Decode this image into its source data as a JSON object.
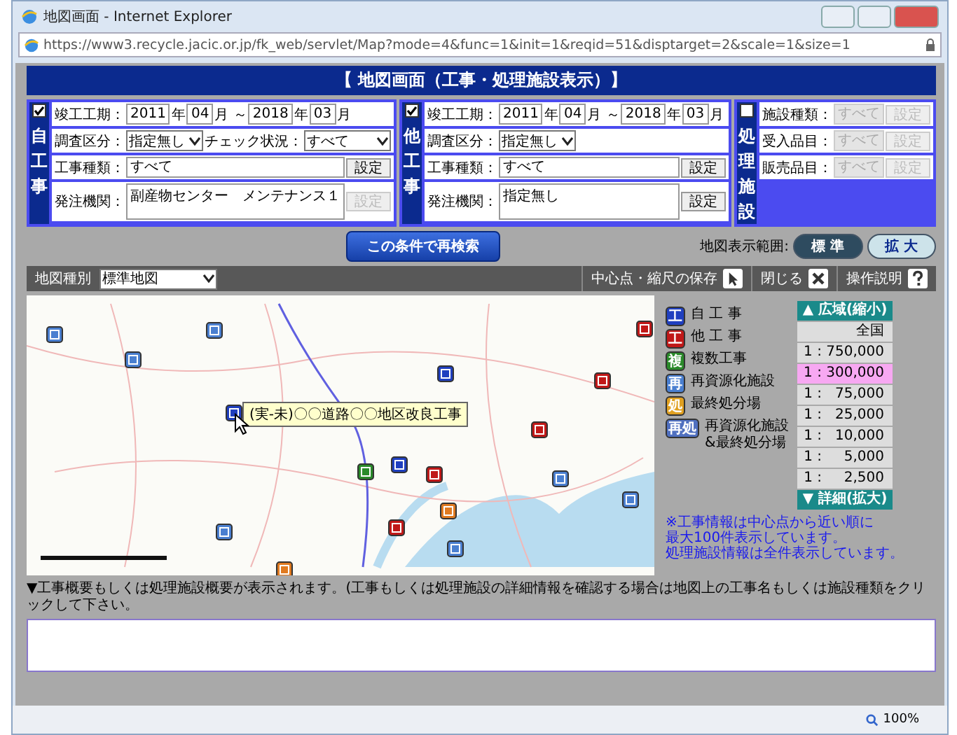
{
  "window": {
    "title": "地図画面 - Internet Explorer",
    "url": "https://www3.recycle.jacic.or.jp/fk_web/servlet/Map?mode=4&func=1&init=1&reqid=51&disptarget=2&scale=1&size=1"
  },
  "header": "【 地図画面（工事・処理施設表示）】",
  "panels": [
    {
      "label": "自工事",
      "checked": true,
      "rows": [
        {
          "items": [
            {
              "kind": "label",
              "text": "竣工工期："
            },
            {
              "kind": "input",
              "value": "2011"
            },
            {
              "kind": "label",
              "text": "年"
            },
            {
              "kind": "input",
              "value": "04"
            },
            {
              "kind": "label",
              "text": "月 ～"
            },
            {
              "kind": "input",
              "value": "2018"
            },
            {
              "kind": "label",
              "text": "年"
            },
            {
              "kind": "input",
              "value": "03"
            },
            {
              "kind": "label",
              "text": "月"
            }
          ]
        },
        {
          "items": [
            {
              "kind": "label",
              "text": "調査区分："
            },
            {
              "kind": "select",
              "value": "指定無し"
            },
            {
              "kind": "label",
              "text": "チェック状況："
            },
            {
              "kind": "long_select",
              "value": "すべて"
            }
          ]
        },
        {
          "items": [
            {
              "kind": "label",
              "text": "工事種類："
            },
            {
              "kind": "long_input",
              "value": "すべて",
              "disabled": false
            },
            {
              "kind": "button",
              "text": "設定",
              "disabled": false
            }
          ]
        },
        {
          "items": [
            {
              "kind": "label",
              "text": "発注機関："
            },
            {
              "kind": "area",
              "value": "副産物センター　メンテナンス１"
            },
            {
              "kind": "button",
              "text": "設定",
              "disabled": true
            }
          ]
        }
      ]
    },
    {
      "label": "他工事",
      "checked": true,
      "rows": [
        {
          "items": [
            {
              "kind": "label",
              "text": "竣工工期："
            },
            {
              "kind": "input",
              "value": "2011"
            },
            {
              "kind": "label",
              "text": "年"
            },
            {
              "kind": "input",
              "value": "04"
            },
            {
              "kind": "label",
              "text": "月 ～"
            },
            {
              "kind": "input",
              "value": "2018"
            },
            {
              "kind": "label",
              "text": "年"
            },
            {
              "kind": "input",
              "value": "03"
            },
            {
              "kind": "label",
              "text": "月"
            }
          ]
        },
        {
          "items": [
            {
              "kind": "label",
              "text": "調査区分："
            },
            {
              "kind": "select",
              "value": "指定無し"
            }
          ]
        },
        {
          "items": [
            {
              "kind": "label",
              "text": "工事種類："
            },
            {
              "kind": "long_input",
              "value": "すべて",
              "disabled": false
            },
            {
              "kind": "button",
              "text": "設定",
              "disabled": false
            }
          ]
        },
        {
          "items": [
            {
              "kind": "label",
              "text": "発注機関："
            },
            {
              "kind": "area",
              "value": "指定無し"
            },
            {
              "kind": "button",
              "text": "設定",
              "disabled": false
            }
          ]
        }
      ]
    },
    {
      "label": "処理施設",
      "checked": false,
      "rows": [
        {
          "items": [
            {
              "kind": "label",
              "text": "施設種類："
            },
            {
              "kind": "long_input",
              "value": "すべて",
              "disabled": true
            },
            {
              "kind": "button",
              "text": "設定",
              "disabled": true
            }
          ]
        },
        {
          "items": [
            {
              "kind": "label",
              "text": "受入品目："
            },
            {
              "kind": "long_input",
              "value": "すべて",
              "disabled": true
            },
            {
              "kind": "button",
              "text": "設定",
              "disabled": true
            }
          ]
        },
        {
          "items": [
            {
              "kind": "label",
              "text": "販売品目："
            },
            {
              "kind": "long_input",
              "value": "すべて",
              "disabled": true
            },
            {
              "kind": "button",
              "text": "設定",
              "disabled": true
            }
          ]
        }
      ]
    }
  ],
  "search_button": "この条件で再検索",
  "range": {
    "label": "地図表示範囲:",
    "options": [
      {
        "text": "標 準",
        "selected": true
      },
      {
        "text": "拡 大",
        "selected": false
      }
    ]
  },
  "toolbar": {
    "map_type_label": "地図種別",
    "map_type": "標準地図",
    "actions": [
      {
        "text": "中心点・縮尺の保存"
      },
      {
        "text": "閉じる"
      },
      {
        "text": "操作説明"
      }
    ]
  },
  "tooltip": "(実-未)〇〇道路〇〇地区改良工事",
  "legend": [
    {
      "symbol": "工",
      "label": "自 工 事",
      "color": "#1f3fbf"
    },
    {
      "symbol": "工",
      "label": "他 工 事",
      "color": "#c01818"
    },
    {
      "symbol": "複",
      "label": "複数工事",
      "color": "#2a8a2a"
    },
    {
      "symbol": "再",
      "label": "再資源化施設",
      "color": "#4a7fd0"
    },
    {
      "symbol": "処",
      "label": "最終処分場",
      "color": "#e0a020"
    },
    {
      "symbol": "再処",
      "label": "再資源化施設\n&最終処分場",
      "color": "#5070c0"
    }
  ],
  "scales": {
    "up": "▲ 広域(縮小)",
    "down": "▼ 詳細(拡大)",
    "items": [
      {
        "text": "全国",
        "selected": false
      },
      {
        "text": "1 : 750,000",
        "selected": false
      },
      {
        "text": "1 : 300,000",
        "selected": true
      },
      {
        "text": "1 :   75,000",
        "selected": false
      },
      {
        "text": "1 :   25,000",
        "selected": false
      },
      {
        "text": "1 :   10,000",
        "selected": false
      },
      {
        "text": "1 :     5,000",
        "selected": false
      },
      {
        "text": "1 :     2,500",
        "selected": false
      }
    ]
  },
  "note": [
    "※工事情報は中心点から近い順に",
    "最大100件表示しています。",
    "処理施設情報は全件表示しています。"
  ],
  "summary_label": "▼工事概要もしくは処理施設概要が表示されます。(工事もしくは処理施設の詳細情報を確認する場合は地図上の工事名もしくは施設種類をクリックして下さい。",
  "status_bar": {
    "zoom": "100%"
  }
}
